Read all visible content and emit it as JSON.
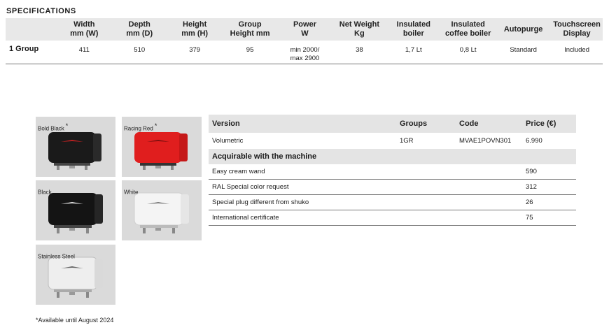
{
  "section_title": "SPECIFICATIONS",
  "spec": {
    "headers": [
      [
        "",
        ""
      ],
      [
        "Width",
        "mm (W)"
      ],
      [
        "Depth",
        "mm (D)"
      ],
      [
        "Height",
        "mm (H)"
      ],
      [
        "Group",
        "Height mm"
      ],
      [
        "Power",
        "W"
      ],
      [
        "Net Weight",
        "Kg"
      ],
      [
        "Insulated",
        "boiler"
      ],
      [
        "Insulated",
        "coffee boiler"
      ],
      [
        "Autopurge",
        ""
      ],
      [
        "Touchscreen",
        "Display"
      ]
    ],
    "row": {
      "label": "1 Group",
      "width": "411",
      "depth": "510",
      "height": "379",
      "group_height": "95",
      "power_1": "min 2000/",
      "power_2": "max 2900",
      "net_weight": "38",
      "insulated_boiler": "1,7 Lt",
      "insulated_coffee_boiler": "0,8 Lt",
      "autopurge": "Standard",
      "touchscreen": "Included"
    }
  },
  "swatches": [
    {
      "name": "Bold Black",
      "star": "*",
      "color": "#1a1a1a"
    },
    {
      "name": "Racing Red",
      "star": "*",
      "color": "#e01e1e"
    },
    {
      "name": "Black",
      "star": "",
      "color": "#141414"
    },
    {
      "name": "White",
      "star": "",
      "color": "#f4f4f4"
    },
    {
      "name": "Stainless Steel",
      "star": "",
      "color": "#eeeeee"
    }
  ],
  "price": {
    "headers": [
      "Version",
      "Groups",
      "Code",
      "Price (€)"
    ],
    "version_row": [
      "Volumetric",
      "1GR",
      "MVAE1POVN301",
      "6.990"
    ],
    "subhead": "Acquirable with the machine",
    "options": [
      {
        "name": "Easy cream wand",
        "price": "590"
      },
      {
        "name": "RAL Special color request",
        "price": "312"
      },
      {
        "name": "Special plug different from shuko",
        "price": "26"
      },
      {
        "name": "International certificate",
        "price": "75"
      }
    ]
  },
  "footnote": "*Available until August 2024"
}
